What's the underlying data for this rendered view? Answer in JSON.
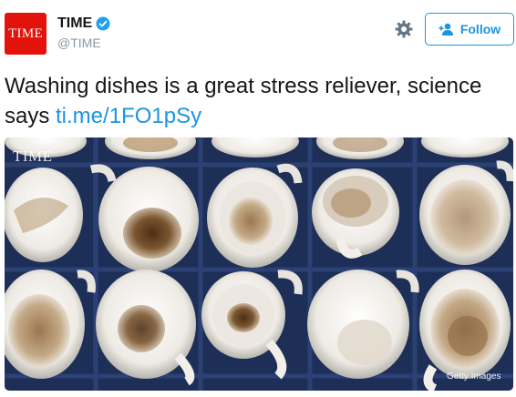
{
  "account": {
    "avatar_text": "TIME",
    "display_name": "TIME",
    "handle": "@TIME",
    "verified": true
  },
  "actions": {
    "follow_label": "Follow",
    "settings_icon": "gear-icon",
    "follow_icon": "add-user-icon"
  },
  "tweet": {
    "text_before_link": "Washing dishes is a great stress reliever, science says ",
    "link_text": "ti.me/1FO1pSy"
  },
  "media": {
    "watermark": "TIME",
    "credit": "Getty Images"
  },
  "colors": {
    "brand_red": "#e3120b",
    "link_blue": "#1b95e0",
    "rack_blue": "#1e2f57"
  }
}
